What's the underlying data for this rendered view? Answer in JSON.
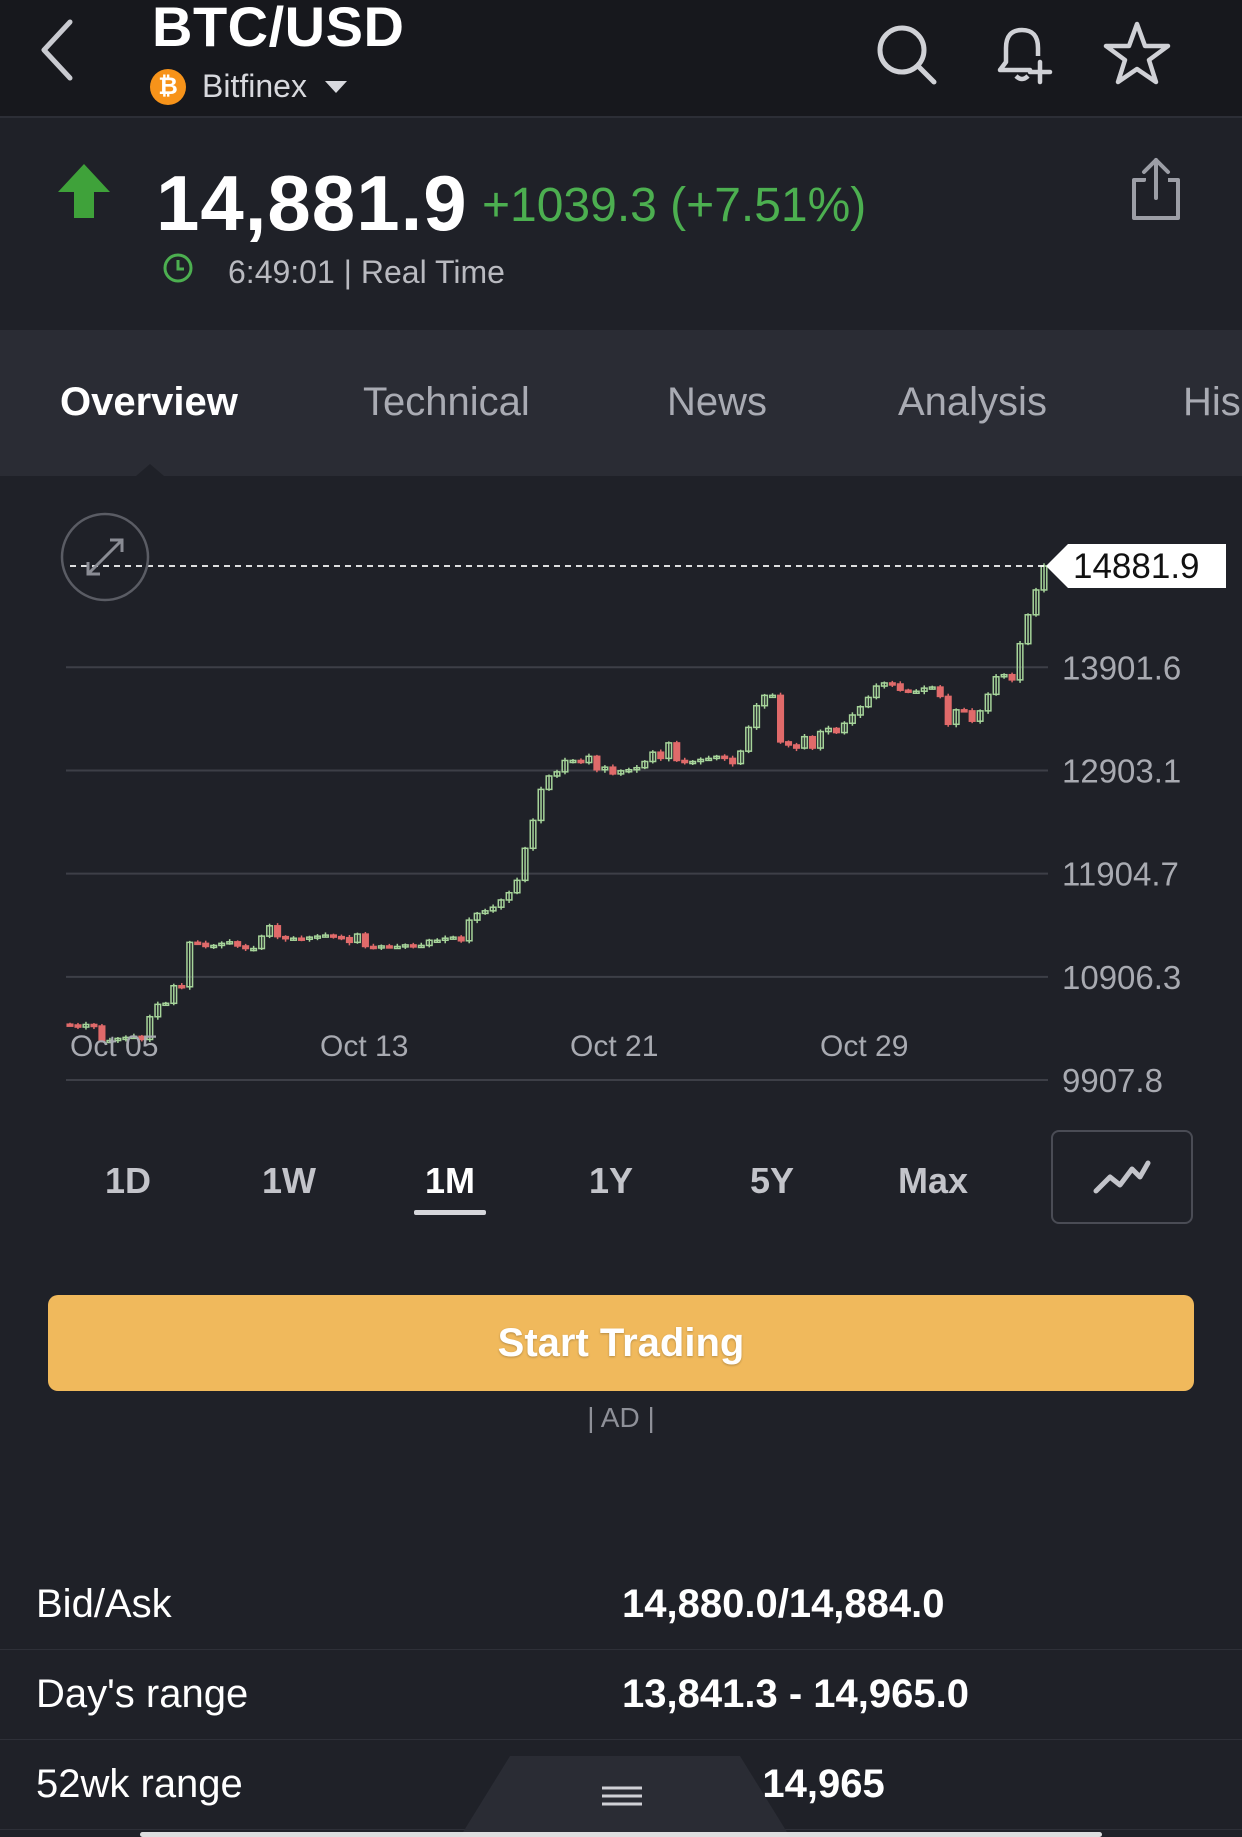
{
  "header": {
    "title": "BTC/USD",
    "exchange": "Bitfinex",
    "exchange_icon": "bitcoin-icon",
    "icons": [
      "back-icon",
      "search-icon",
      "bell-plus-icon",
      "star-icon"
    ]
  },
  "quote": {
    "price": "14,881.9",
    "change": "+1039.3 (+7.51%)",
    "time": "6:49:01 | Real Time",
    "direction": "up",
    "up_color": "#4caf50"
  },
  "tabs": [
    {
      "label": "Overview",
      "active": true
    },
    {
      "label": "Technical",
      "active": false
    },
    {
      "label": "News",
      "active": false
    },
    {
      "label": "Analysis",
      "active": false
    },
    {
      "label": "His",
      "active": false
    }
  ],
  "chart_data": {
    "type": "candlestick",
    "current_price_label": "14881.9",
    "y_ticks": [
      "13901.6",
      "12903.1",
      "11904.7",
      "10906.3",
      "9907.8"
    ],
    "ylim": [
      9907.8,
      14881.9
    ],
    "x_ticks": [
      "Oct 05",
      "Oct 13",
      "Oct 21",
      "Oct 29"
    ],
    "series": [
      {
        "values": [
          10440,
          10420,
          10445,
          10430,
          10285,
          10290,
          10310,
          10320,
          10330,
          10300,
          10520,
          10640,
          10650,
          10820,
          10810,
          11240,
          11230,
          11200,
          11210,
          11230,
          11245,
          11205,
          11180,
          11180,
          11300,
          11400,
          11295,
          11275,
          11280,
          11270,
          11290,
          11300,
          11310,
          11295,
          11285,
          11240,
          11320,
          11200,
          11195,
          11205,
          11195,
          11200,
          11215,
          11210,
          11210,
          11260,
          11260,
          11280,
          11290,
          11255,
          11455,
          11520,
          11545,
          11580,
          11650,
          11720,
          11840,
          12150,
          12420,
          12720,
          12850,
          12890,
          13000,
          13000,
          12980,
          13040,
          12910,
          12935,
          12870,
          12900,
          12910,
          12930,
          12990,
          13080,
          13020,
          13170,
          13000,
          12980,
          12990,
          13010,
          13020,
          13040,
          13020,
          12970,
          13090,
          13320,
          13530,
          13630,
          13630,
          13180,
          13150,
          13120,
          13230,
          13120,
          13280,
          13310,
          13270,
          13360,
          13440,
          13520,
          13610,
          13720,
          13750,
          13740,
          13680,
          13670,
          13670,
          13700,
          13710,
          13620,
          13350,
          13490,
          13480,
          13380,
          13480,
          13640,
          13810,
          13830,
          13780,
          14130,
          14410,
          14650,
          14882
        ]
      }
    ]
  },
  "ranges": [
    {
      "label": "1D",
      "active": false
    },
    {
      "label": "1W",
      "active": false
    },
    {
      "label": "1M",
      "active": true
    },
    {
      "label": "1Y",
      "active": false
    },
    {
      "label": "5Y",
      "active": false
    },
    {
      "label": "Max",
      "active": false
    }
  ],
  "cta": {
    "label": "Start Trading",
    "color": "#f0b95c"
  },
  "ad_label": "| AD |",
  "stats": [
    {
      "label": "Bid/Ask",
      "value": "14,880.0/14,884.0"
    },
    {
      "label": "Day's range",
      "value": "13,841.3 - 14,965.0"
    },
    {
      "label": "52wk range",
      "value": "- 14,965"
    }
  ]
}
